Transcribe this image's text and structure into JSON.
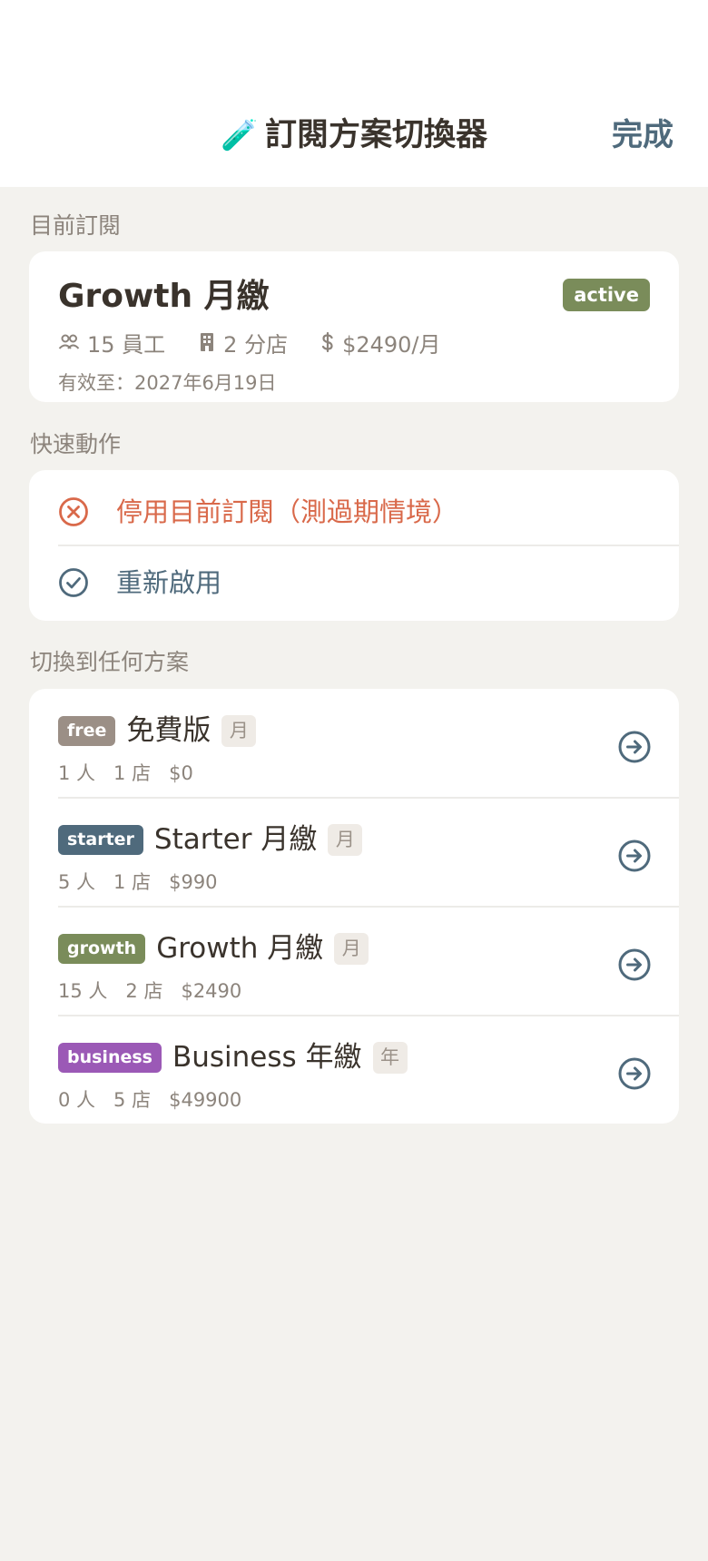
{
  "nav": {
    "emoji": "🧪",
    "title": "訂閱方案切換器",
    "done_label": "完成"
  },
  "current": {
    "section_label": "目前訂閱",
    "name": "Growth 月繳",
    "status": "active",
    "employees": "15 員工",
    "branches": "2 分店",
    "price": "$2490/月",
    "valid_until": "有效至：2027年6月19日",
    "icons": [
      "people-icon",
      "building-icon",
      "dollar-icon"
    ]
  },
  "quick_actions": {
    "section_label": "快速動作",
    "items": [
      {
        "label": "停用目前訂閱（測過期情境）",
        "icon": "x-circle-icon",
        "color": "#d9694a"
      },
      {
        "label": "重新啟用",
        "icon": "check-circle-icon",
        "color": "#4f6a7c"
      }
    ]
  },
  "plans": {
    "section_label": "切換到任何方案",
    "items": [
      {
        "key": "free",
        "key_color": "#9b8f86",
        "name": "免費版",
        "period": "月",
        "people": "1 人",
        "stores": "1 店",
        "price": "$0"
      },
      {
        "key": "starter",
        "key_color": "#4f6a7c",
        "name": "Starter 月繳",
        "period": "月",
        "people": "5 人",
        "stores": "1 店",
        "price": "$990"
      },
      {
        "key": "growth",
        "key_color": "#7a8c5a",
        "name": "Growth 月繳",
        "period": "月",
        "people": "15 人",
        "stores": "2 店",
        "price": "$2490"
      },
      {
        "key": "business",
        "key_color": "#9b59b6",
        "name": "Business 年繳",
        "period": "年",
        "people": "0 人",
        "stores": "5 店",
        "price": "$49900"
      }
    ]
  }
}
